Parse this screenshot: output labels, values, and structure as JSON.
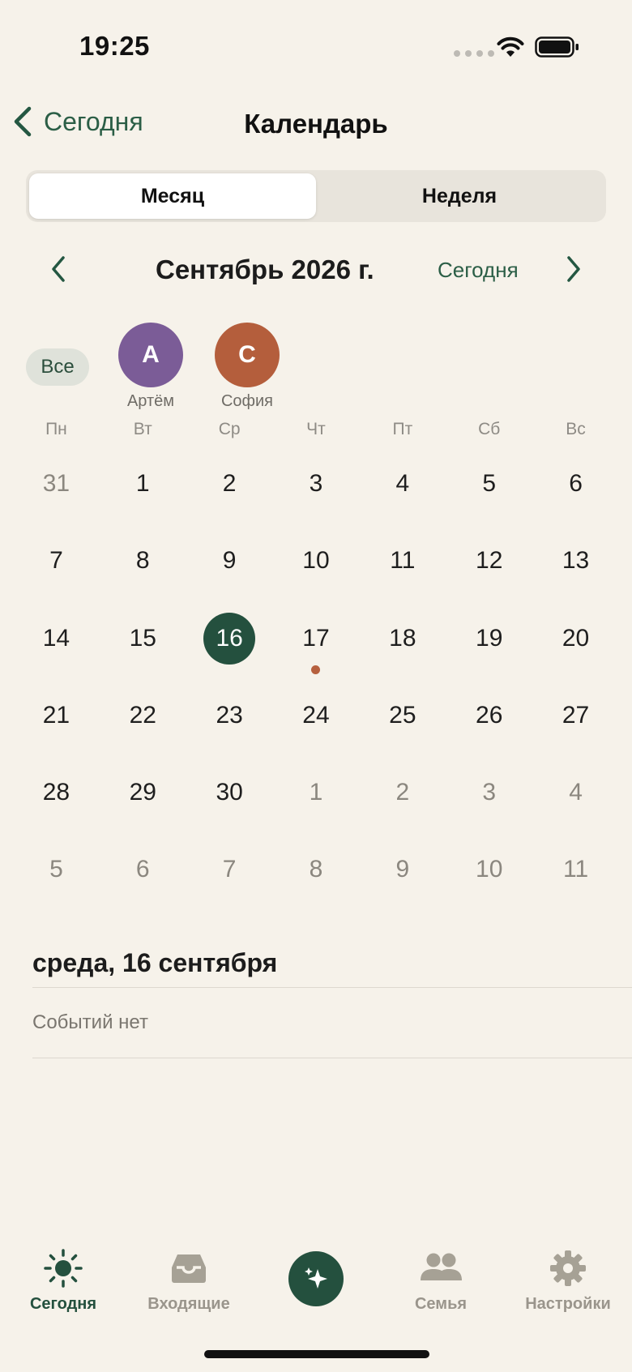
{
  "status": {
    "time": "19:25"
  },
  "nav": {
    "back_label": "Сегодня",
    "title": "Календарь"
  },
  "segments": [
    {
      "label": "Месяц",
      "active": true
    },
    {
      "label": "Неделя",
      "active": false
    }
  ],
  "month": {
    "title": "Сентябрь 2026 г.",
    "today_label": "Сегодня"
  },
  "members": {
    "all_label": "Все",
    "people": [
      {
        "initial": "А",
        "name": "Артём",
        "color": "#7B5C97"
      },
      {
        "initial": "С",
        "name": "София",
        "color": "#B45E3C"
      }
    ]
  },
  "weekdays": [
    "Пн",
    "Вт",
    "Ср",
    "Чт",
    "Пт",
    "Сб",
    "Вс"
  ],
  "days": [
    {
      "n": "31",
      "m": true
    },
    {
      "n": "1"
    },
    {
      "n": "2"
    },
    {
      "n": "3"
    },
    {
      "n": "4"
    },
    {
      "n": "5"
    },
    {
      "n": "6"
    },
    {
      "n": "7"
    },
    {
      "n": "8"
    },
    {
      "n": "9"
    },
    {
      "n": "10"
    },
    {
      "n": "11"
    },
    {
      "n": "12"
    },
    {
      "n": "13"
    },
    {
      "n": "14"
    },
    {
      "n": "15"
    },
    {
      "n": "16",
      "selected": true
    },
    {
      "n": "17",
      "event": true
    },
    {
      "n": "18"
    },
    {
      "n": "19"
    },
    {
      "n": "20"
    },
    {
      "n": "21"
    },
    {
      "n": "22"
    },
    {
      "n": "23"
    },
    {
      "n": "24"
    },
    {
      "n": "25"
    },
    {
      "n": "26"
    },
    {
      "n": "27"
    },
    {
      "n": "28"
    },
    {
      "n": "29"
    },
    {
      "n": "30"
    },
    {
      "n": "1",
      "m": true
    },
    {
      "n": "2",
      "m": true
    },
    {
      "n": "3",
      "m": true
    },
    {
      "n": "4",
      "m": true
    },
    {
      "n": "5",
      "m": true
    },
    {
      "n": "6",
      "m": true
    },
    {
      "n": "7",
      "m": true
    },
    {
      "n": "8",
      "m": true
    },
    {
      "n": "9",
      "m": true
    },
    {
      "n": "10",
      "m": true
    },
    {
      "n": "11",
      "m": true
    }
  ],
  "day_section": {
    "heading": "среда, 16 сентября",
    "empty": "Событий нет"
  },
  "tabs": [
    {
      "label": "Сегодня",
      "icon": "sun-icon",
      "active": true
    },
    {
      "label": "Входящие",
      "icon": "tray-icon",
      "active": false
    },
    {
      "label": "",
      "icon": "sparkles-icon",
      "active": false
    },
    {
      "label": "Семья",
      "icon": "people-icon",
      "active": false
    },
    {
      "label": "Настройки",
      "icon": "gear-icon",
      "active": false
    }
  ],
  "colors": {
    "accent": "#24503E",
    "event_dot": "#B6603E",
    "background": "#F6F2EA"
  }
}
